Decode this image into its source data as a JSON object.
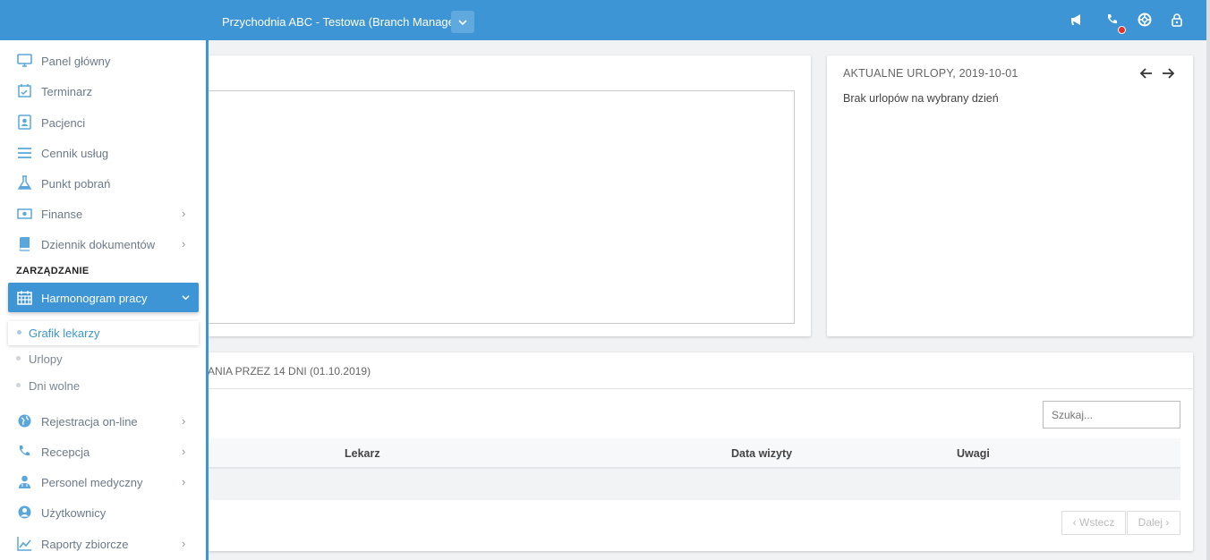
{
  "topbar": {
    "title": "Przychodnia ABC - Testowa (Branch Manager)",
    "dropdown_icon": "chevron-down-icon",
    "icons": [
      "megaphone-icon",
      "phone-icon",
      "lifebuoy-icon",
      "lock-icon"
    ]
  },
  "sidebar": {
    "items": [
      {
        "label": "Panel główny",
        "icon": "monitor-icon"
      },
      {
        "label": "Terminarz",
        "icon": "calendar-check-icon"
      },
      {
        "label": "Pacjenci",
        "icon": "contact-card-icon"
      },
      {
        "label": "Cennik usług",
        "icon": "list-icon"
      },
      {
        "label": "Punkt pobrań",
        "icon": "flask-icon"
      },
      {
        "label": "Finanse",
        "icon": "banknote-icon"
      },
      {
        "label": "Dziennik dokumentów",
        "icon": "book-icon"
      }
    ],
    "section_label": "ZARZĄDZANIE",
    "active": {
      "label": "Harmonogram pracy",
      "icon": "calendar-grid-icon"
    },
    "sub_items": [
      {
        "label": "Grafik lekarzy"
      },
      {
        "label": "Urlopy"
      },
      {
        "label": "Dni wolne"
      }
    ],
    "items2": [
      {
        "label": "Rejestracja on-line",
        "icon": "globe-icon"
      },
      {
        "label": "Recepcja",
        "icon": "phone-icon"
      },
      {
        "label": "Personel medyczny",
        "icon": "doctor-icon"
      },
      {
        "label": "Użytkownicy",
        "icon": "user-circle-icon"
      },
      {
        "label": "Raporty zbiorcze",
        "icon": "line-chart-icon"
      }
    ]
  },
  "urlopy": {
    "title": "AKTUALNE URLOPY, 2019-10-01",
    "empty_text": "Brak urlopów na wybrany dzień"
  },
  "bottom": {
    "title": "ANIA PRZEZ 14 DNI (01.10.2019)",
    "search_placeholder": "Szukaj...",
    "columns": [
      "Lekarz",
      "Data wizyty",
      "Uwagi"
    ],
    "prev_label": "‹  Wstecz",
    "next_label": "Dalej  ›"
  },
  "colors": {
    "accent": "#3d95d5",
    "notification": "#e2322a"
  }
}
